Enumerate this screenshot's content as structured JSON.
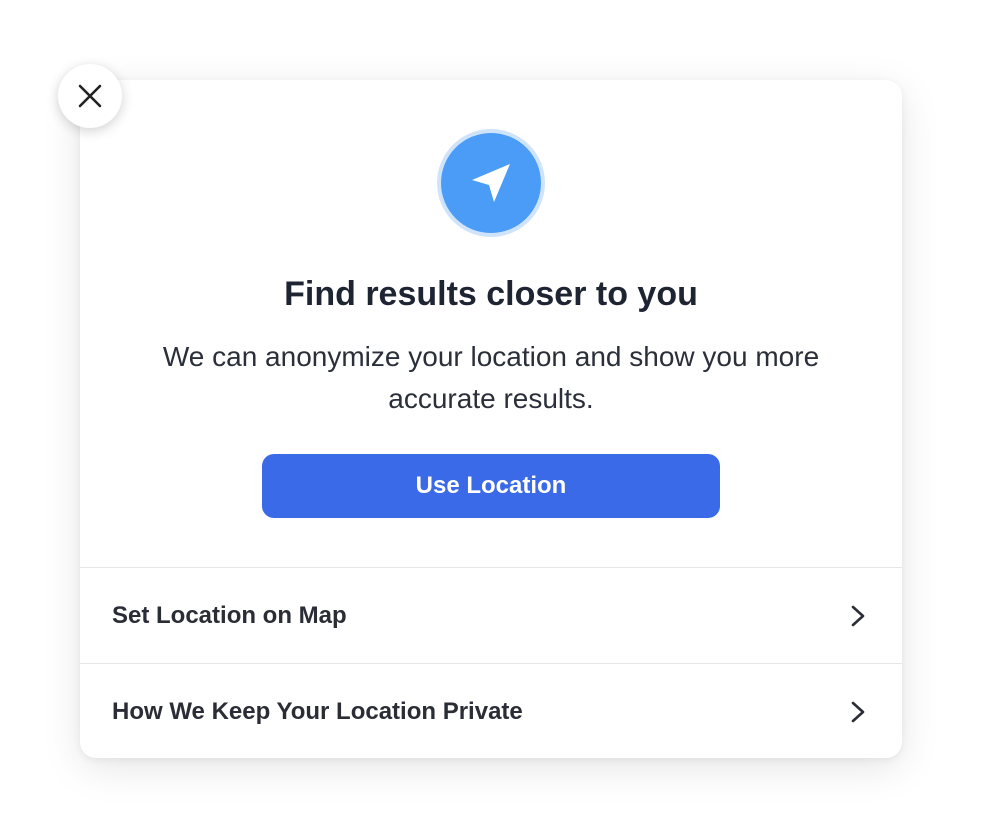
{
  "dialog": {
    "close_icon": "close-icon",
    "hero_icon": "location-arrow-icon",
    "title": "Find results closer to you",
    "subtitle": "We can anonymize your location and show you more accurate results.",
    "primary_button": "Use Location",
    "options": [
      {
        "label": "Set Location on Map",
        "icon": "chevron-right-icon"
      },
      {
        "label": "How We Keep Your Location Private",
        "icon": "chevron-right-icon"
      }
    ]
  },
  "colors": {
    "primary": "#3a6ae8",
    "hero_icon_bg": "#4b9cf6",
    "text_dark": "#1f2433"
  }
}
